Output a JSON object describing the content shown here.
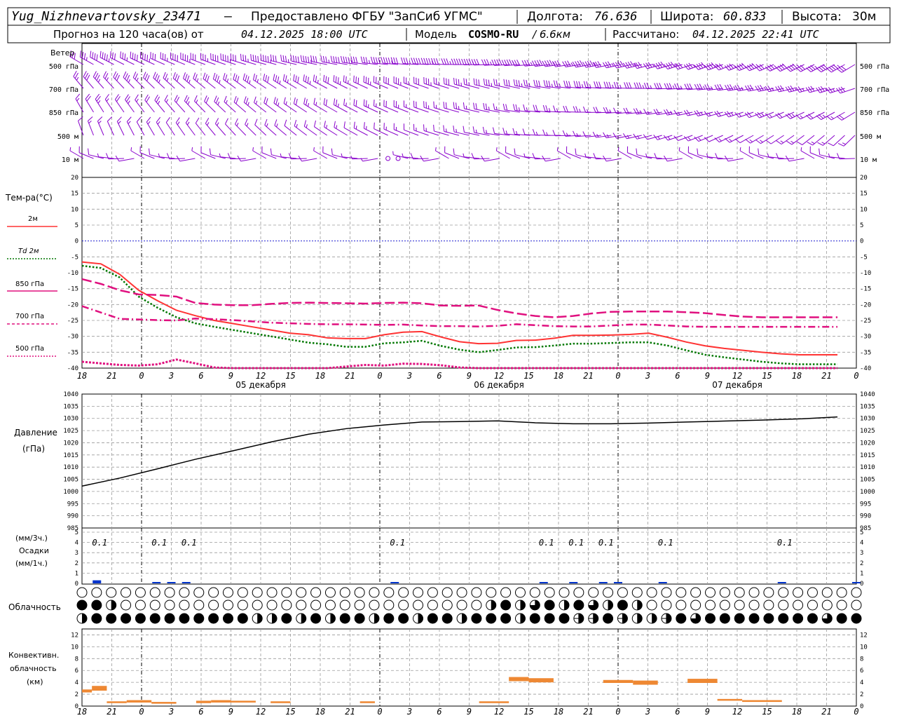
{
  "header": {
    "station": "Yug_Nizhnevartovsky_23471",
    "provider": "Предоставлено ФГБУ \"ЗапСиб УГМС\"",
    "lon_label": "Долгота:",
    "lon_value": "76.636",
    "lat_label": "Широта:",
    "lat_value": "60.833",
    "alt_label": "Высота:",
    "alt_value": "30м",
    "forecast_prefix": "Прогноз на 120 часа(ов) от",
    "forecast_time": "04.12.2025 18:00 UTC",
    "model_prefix": "Модель",
    "model_name": "COSMO-RU",
    "model_res": "/ 6.6км",
    "calc_prefix": "Рассчитано:",
    "calc_time": "04.12.2025 22:41 UTC"
  },
  "time_axis": {
    "tick_labels": [
      "18",
      "21",
      "0",
      "3",
      "6",
      "9",
      "12",
      "15",
      "18",
      "21",
      "0",
      "3",
      "6",
      "9",
      "12",
      "15",
      "18",
      "21",
      "0",
      "3",
      "6",
      "9",
      "12",
      "15",
      "18",
      "21",
      "0"
    ],
    "day_labels": [
      "05 декабря",
      "06 декабря",
      "07 декабря"
    ]
  },
  "wind_panel": {
    "title": "Ветер",
    "levels": [
      "500 гПа",
      "700 гПа",
      "850 гПа",
      "500 м",
      "10  м"
    ]
  },
  "temp_panel": {
    "title": "Тем-ра(°С)",
    "legend": [
      {
        "label": "2м",
        "color": "#ff3333",
        "dash": "solid"
      },
      {
        "label": "Td  2м",
        "color": "#007700",
        "dash": "dot"
      },
      {
        "label": "850 гПа",
        "color": "#e0107f",
        "dash": "longdash"
      },
      {
        "label": "700 гПа",
        "color": "#e0107f",
        "dash": "dashdot"
      },
      {
        "label": "500 гПа",
        "color": "#e0107f",
        "dash": "dot"
      }
    ],
    "yticks": [
      "20",
      "15",
      "10",
      "5",
      "0",
      "-5",
      "-10",
      "-15",
      "-20",
      "-25",
      "-30",
      "-35",
      "-40"
    ]
  },
  "pressure_panel": {
    "title": "Давление",
    "unit": "(гПа)",
    "yticks": [
      "1040",
      "1035",
      "1030",
      "1025",
      "1020",
      "1015",
      "1010",
      "1005",
      "1000",
      "995",
      "990",
      "985"
    ]
  },
  "precip_panel": {
    "unit_top": "(мм/3ч.)",
    "title": "Осадки",
    "unit_bottom": "(мм/1ч.)",
    "yticks": [
      "5",
      "4",
      "3",
      "2",
      "1",
      "0"
    ],
    "amount_labels": [
      {
        "t": 1,
        "text": "0.1"
      },
      {
        "t": 5,
        "text": "0.1"
      },
      {
        "t": 7,
        "text": "0.1"
      },
      {
        "t": 21,
        "text": "0.1"
      },
      {
        "t": 31,
        "text": "0.1"
      },
      {
        "t": 33,
        "text": "0.1"
      },
      {
        "t": 35,
        "text": "0.1"
      },
      {
        "t": 39,
        "text": "0.1"
      },
      {
        "t": 47,
        "text": "0.1"
      }
    ]
  },
  "cloud_panel": {
    "title": "Облачность",
    "rows": 3
  },
  "conv_panel": {
    "title_1": "Конвективн.",
    "title_2": "облачность",
    "unit": "(км)",
    "yticks": [
      "12",
      "10",
      "8",
      "6",
      "4",
      "2",
      "0"
    ]
  },
  "chart_data": [
    {
      "type": "line",
      "title": "Тем-ра(°С)",
      "x_hours": [
        0,
        3,
        6,
        9,
        12,
        15,
        18,
        21,
        24,
        27,
        30,
        33,
        36,
        39,
        42,
        45,
        48,
        51,
        54,
        57,
        60,
        63,
        66,
        69,
        72,
        75,
        78,
        81,
        84,
        87,
        90,
        93,
        96,
        99,
        102,
        105,
        108,
        111,
        114,
        117,
        120
      ],
      "ylim": [
        -40,
        20
      ],
      "series": [
        {
          "name": "2м",
          "color": "#ff3333",
          "values": [
            -6.6,
            -7.2,
            -10.5,
            -15.5,
            -18.8,
            -21.8,
            -23.5,
            -25,
            -26,
            -27,
            -28,
            -29,
            -29.5,
            -30.5,
            -30.7,
            -30.7,
            -29.5,
            -28.7,
            -28.5,
            -30.2,
            -31.7,
            -32.3,
            -32.2,
            -31.3,
            -31.2,
            -30.6,
            -29.7,
            -29.7,
            -29.6,
            -29.4,
            -29,
            -30.3,
            -31.8,
            -33,
            -33.8,
            -34.4,
            -35,
            -35.5,
            -35.8,
            -35.8,
            -35.8
          ]
        },
        {
          "name": "Td 2м",
          "color": "#007700",
          "values": [
            -7.8,
            -8.5,
            -11.5,
            -17.5,
            -21,
            -24,
            -25.9,
            -27,
            -28,
            -29,
            -30,
            -31,
            -32,
            -32.5,
            -33.3,
            -33.3,
            -32.2,
            -31.9,
            -31.4,
            -33,
            -34.2,
            -35,
            -34.3,
            -33.5,
            -33.4,
            -32.9,
            -32.3,
            -32.3,
            -32.1,
            -31.9,
            -31.9,
            -32.9,
            -34.4,
            -35.8,
            -36.6,
            -37.3,
            -38,
            -38.5,
            -38.8,
            -38.8,
            -38.8
          ]
        },
        {
          "name": "850 гПа",
          "color": "#e0107f",
          "values": [
            -12,
            -13.5,
            -15.5,
            -16.8,
            -17,
            -17.5,
            -19.5,
            -20,
            -20.2,
            -20.2,
            -19.8,
            -19.5,
            -19.4,
            -19.5,
            -19.6,
            -19.7,
            -19.5,
            -19.4,
            -19.6,
            -20.3,
            -20.4,
            -20.3,
            -21.7,
            -22.8,
            -23.6,
            -24,
            -23.6,
            -22.8,
            -22.3,
            -22.2,
            -22.2,
            -22.2,
            -22.4,
            -22.7,
            -23.3,
            -23.8,
            -24,
            -24,
            -24,
            -24,
            -24
          ]
        },
        {
          "name": "700 гПа",
          "color": "#e0107f",
          "values": [
            -20.5,
            -22.5,
            -24.5,
            -24.7,
            -24.9,
            -25,
            -24.4,
            -24.6,
            -24.9,
            -25.3,
            -25.7,
            -25.9,
            -26.1,
            -26.2,
            -26.2,
            -26.3,
            -26.4,
            -26.3,
            -26.6,
            -26.8,
            -26.8,
            -26.9,
            -26.7,
            -26.2,
            -26.5,
            -26.8,
            -26.9,
            -26.9,
            -26.6,
            -26.3,
            -26.3,
            -26.6,
            -26.9,
            -27,
            -27,
            -27,
            -27,
            -27,
            -27,
            -27,
            -27
          ]
        },
        {
          "name": "500 гПа",
          "color": "#e0107f",
          "values": [
            -38,
            -38.5,
            -39,
            -39.2,
            -38.8,
            -37.3,
            -38.5,
            -39.8,
            -40,
            -40,
            -40,
            -40,
            -40,
            -40,
            -39.5,
            -39,
            -39.2,
            -38.6,
            -38.7,
            -39.1,
            -39.8,
            -40,
            -40,
            -40,
            -40,
            -40,
            -40,
            -40,
            -40,
            -40,
            -40,
            -40,
            -40,
            -40,
            -40,
            -40,
            -40,
            -40,
            -40,
            -40,
            -40
          ]
        }
      ]
    },
    {
      "type": "line",
      "title": "Давление",
      "x_hours": [
        0,
        6,
        12,
        18,
        24,
        30,
        36,
        42,
        48,
        54,
        60,
        66,
        72,
        78,
        84,
        90,
        96,
        102,
        108,
        114,
        120
      ],
      "ylim": [
        985,
        1040
      ],
      "series": [
        {
          "name": "Давление",
          "color": "#000000",
          "values": [
            1002.2,
            1005.5,
            1009.3,
            1013.2,
            1016.7,
            1020.3,
            1023.5,
            1025.8,
            1027.3,
            1028.5,
            1028.7,
            1029,
            1028.2,
            1027.8,
            1027.8,
            1028.1,
            1028.5,
            1028.9,
            1029.3,
            1029.8,
            1030.6
          ]
        }
      ]
    },
    {
      "type": "bar",
      "title": "Конвективн. облачность",
      "ylim": [
        0,
        13
      ],
      "bars": [
        {
          "h0": -1,
          "h1": 0,
          "lo": 2.3,
          "hi": 2.8
        },
        {
          "h0": 1,
          "h1": 3,
          "lo": 2.6,
          "hi": 3.4
        },
        {
          "h0": 3,
          "h1": 6,
          "lo": 0.5,
          "hi": 0.8
        },
        {
          "h0": 6,
          "h1": 8,
          "lo": 0.6,
          "hi": 1.0
        },
        {
          "h0": 8,
          "h1": 11,
          "lo": 0.4,
          "hi": 0.7
        },
        {
          "h0": 23,
          "h1": 26,
          "lo": 0.5,
          "hi": 0.9
        },
        {
          "h0": 26,
          "h1": 29,
          "lo": 0.6,
          "hi": 1.0
        },
        {
          "h0": 29,
          "h1": 32,
          "lo": 0.6,
          "hi": 0.9
        },
        {
          "h0": 35,
          "h1": 38,
          "lo": 0.5,
          "hi": 0.8
        },
        {
          "h0": 49,
          "h1": 50,
          "lo": 0.5,
          "hi": 0.8
        },
        {
          "h0": 63,
          "h1": 66,
          "lo": 0.5,
          "hi": 0.8
        },
        {
          "h0": 78,
          "h1": 84,
          "lo": 4.2,
          "hi": 4.9
        },
        {
          "h0": 84,
          "h1": 87,
          "lo": 4.0,
          "hi": 4.7
        },
        {
          "h0": 87,
          "h1": 89,
          "lo": 3.9,
          "hi": 4.4
        },
        {
          "h0": 102,
          "h1": 105,
          "lo": 3.6,
          "hi": 4.3
        },
        {
          "h0": 105,
          "h1": 108,
          "lo": 3.9,
          "hi": 4.6
        },
        {
          "h0": 108,
          "h1": 114,
          "lo": 0.9,
          "hi": 1.2
        },
        {
          "h0": 114,
          "h1": 120,
          "lo": 0.7,
          "hi": 1.0
        }
      ]
    }
  ],
  "precip_bars": {
    "color": "#0033cc",
    "values_mm": [
      {
        "t": 1,
        "v": 0.3
      },
      {
        "t": 5,
        "v": 0.1
      },
      {
        "t": 6,
        "v": 0.1
      },
      {
        "t": 7,
        "v": 0.1
      },
      {
        "t": 21,
        "v": 0.1
      },
      {
        "t": 31,
        "v": 0.1
      },
      {
        "t": 33,
        "v": 0.1
      },
      {
        "t": 35,
        "v": 0.1
      },
      {
        "t": 36,
        "v": 0.1
      },
      {
        "t": 39,
        "v": 0.1
      },
      {
        "t": 47,
        "v": 0.1
      },
      {
        "t": 52,
        "v": 0.1
      }
    ]
  },
  "colors": {
    "wind": "#8800cc",
    "grid": "#999999",
    "zero_line": "#0000cc",
    "conv_bar": "#ee8833",
    "precip": "#0033cc"
  }
}
